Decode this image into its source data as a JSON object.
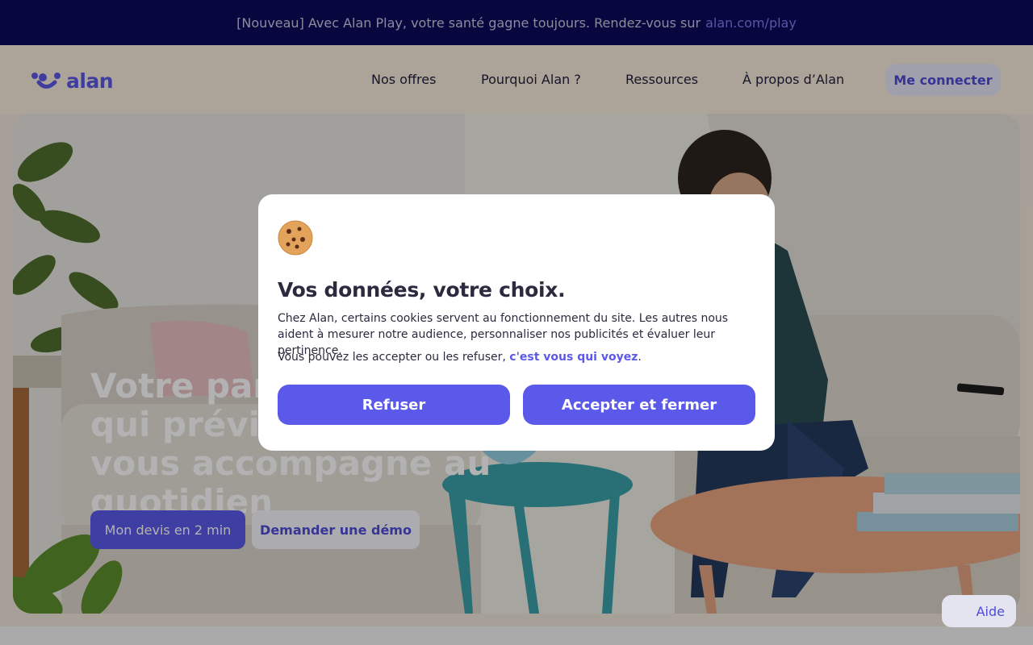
{
  "banner": {
    "text": "[Nouveau] Avec Alan Play, votre santé gagne toujours. Rendez-vous sur",
    "link": "alan.com/play"
  },
  "nav": {
    "logo_text": "alan",
    "items": [
      {
        "label": "Nos offres"
      },
      {
        "label": "Pourquoi Alan ?"
      },
      {
        "label": "Ressources"
      },
      {
        "label": "À propos d’Alan"
      }
    ],
    "login_label": "Me connecter"
  },
  "hero": {
    "title": "Votre partenaire santé qui prévient, protège et vous accompagne au quotidien",
    "primary_cta": "Mon devis en 2 min",
    "secondary_cta": "Demander une démo"
  },
  "help": {
    "label": "Aide"
  },
  "cookie_modal": {
    "icon": "cookie-icon",
    "title": "Vos données, votre choix.",
    "body": "Chez Alan, certains cookies servent au fonctionnement du site. Les autres nous aident à mesurer notre audience, personnaliser nos publicités et évaluer leur pertinence.",
    "body2_prefix": "Vous pouvez les accepter ou les refuser,",
    "body2_link": "c'est vous qui voyez",
    "body2_suffix": ".",
    "refuse_label": "Refuser",
    "accept_label": "Accepter et fermer"
  },
  "colors": {
    "brand": "#5b59ea",
    "banner_bg": "#0b0a5a",
    "nav_bg": "#f6eadb"
  }
}
